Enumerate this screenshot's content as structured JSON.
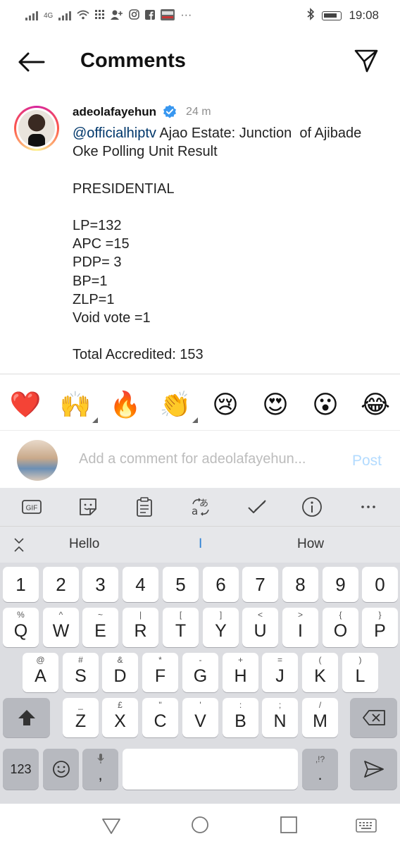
{
  "status_bar": {
    "network": "4G",
    "time": "19:08",
    "more": "···"
  },
  "header": {
    "title": "Comments"
  },
  "caption": {
    "username": "adeolafayehun",
    "time_ago": "24 m",
    "mention": "@officialhiptv",
    "text_after_mention": " Ajao Estate: Junction  of Ajibade Oke Polling Unit Result",
    "lines": [
      "",
      "PRESIDENTIAL",
      "",
      "LP=132",
      "APC =15",
      "PDP= 3",
      "BP=1",
      "ZLP=1",
      "Void vote =1",
      "",
      "Total Accredited: 153"
    ]
  },
  "emoji_bar": [
    "❤️",
    "🙌",
    "🔥",
    "👏",
    "😢",
    "😍",
    "😮",
    "😂"
  ],
  "comment_box": {
    "placeholder": "Add a comment for adeolafayehun...",
    "post_label": "Post"
  },
  "keyboard": {
    "suggestions": [
      "Hello",
      "I",
      "How"
    ],
    "number_row": [
      "1",
      "2",
      "3",
      "4",
      "5",
      "6",
      "7",
      "8",
      "9",
      "0"
    ],
    "row1": [
      {
        "sub": "%",
        "main": "Q"
      },
      {
        "sub": "^",
        "main": "W"
      },
      {
        "sub": "~",
        "main": "E"
      },
      {
        "sub": "|",
        "main": "R"
      },
      {
        "sub": "[",
        "main": "T"
      },
      {
        "sub": "]",
        "main": "Y"
      },
      {
        "sub": "<",
        "main": "U"
      },
      {
        "sub": ">",
        "main": "I"
      },
      {
        "sub": "{",
        "main": "O"
      },
      {
        "sub": "}",
        "main": "P"
      }
    ],
    "row2": [
      {
        "sub": "@",
        "main": "A"
      },
      {
        "sub": "#",
        "main": "S"
      },
      {
        "sub": "&",
        "main": "D"
      },
      {
        "sub": "*",
        "main": "F"
      },
      {
        "sub": "-",
        "main": "G"
      },
      {
        "sub": "+",
        "main": "H"
      },
      {
        "sub": "=",
        "main": "J"
      },
      {
        "sub": "(",
        "main": "K"
      },
      {
        "sub": ")",
        "main": "L"
      }
    ],
    "row3": [
      {
        "sub": "_",
        "main": "Z"
      },
      {
        "sub": "£",
        "main": "X"
      },
      {
        "sub": "\"",
        "main": "C"
      },
      {
        "sub": "'",
        "main": "V"
      },
      {
        "sub": ":",
        "main": "B"
      },
      {
        "sub": ";",
        "main": "N"
      },
      {
        "sub": "/",
        "main": "M"
      }
    ],
    "bottom": {
      "symbols_label": "123",
      "comma": ",",
      "period": ".",
      "period_sub": ",!?"
    }
  },
  "colors": {
    "link": "#00376b",
    "post_disabled": "#b3dbff",
    "verified": "#3897f0"
  }
}
